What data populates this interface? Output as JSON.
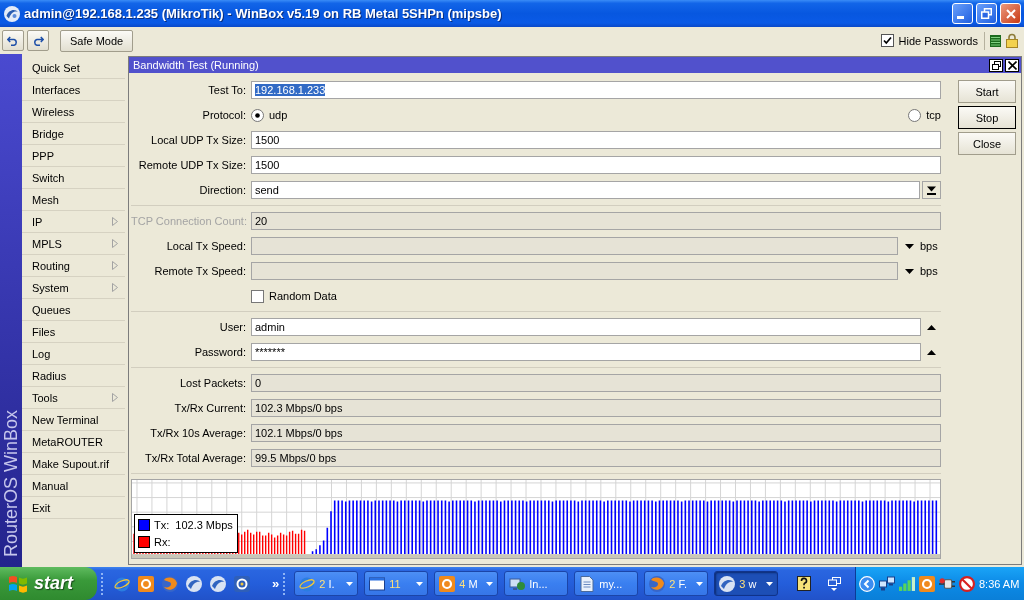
{
  "window": {
    "title": "admin@192.168.1.235 (MikroTik) - WinBox v5.19 on RB Metal 5SHPn (mipsbe)"
  },
  "toolbar": {
    "safe_mode": "Safe Mode",
    "hide_passwords": {
      "label": "Hide Passwords",
      "checked": true
    }
  },
  "sidebar": {
    "brand": "RouterOS WinBox",
    "items": [
      {
        "label": "Quick Set",
        "submenu": false
      },
      {
        "label": "Interfaces",
        "submenu": false
      },
      {
        "label": "Wireless",
        "submenu": false
      },
      {
        "label": "Bridge",
        "submenu": false
      },
      {
        "label": "PPP",
        "submenu": false
      },
      {
        "label": "Switch",
        "submenu": false
      },
      {
        "label": "Mesh",
        "submenu": false
      },
      {
        "label": "IP",
        "submenu": true
      },
      {
        "label": "MPLS",
        "submenu": true
      },
      {
        "label": "Routing",
        "submenu": true
      },
      {
        "label": "System",
        "submenu": true
      },
      {
        "label": "Queues",
        "submenu": false
      },
      {
        "label": "Files",
        "submenu": false
      },
      {
        "label": "Log",
        "submenu": false
      },
      {
        "label": "Radius",
        "submenu": false
      },
      {
        "label": "Tools",
        "submenu": true
      },
      {
        "label": "New Terminal",
        "submenu": false
      },
      {
        "label": "MetaROUTER",
        "submenu": false
      },
      {
        "label": "Make Supout.rif",
        "submenu": false
      },
      {
        "label": "Manual",
        "submenu": false
      },
      {
        "label": "Exit",
        "submenu": false
      }
    ]
  },
  "dialog": {
    "title": "Bandwidth Test (Running)",
    "sections": [
      {
        "rows": [
          {
            "kind": "text",
            "label": "Test To:",
            "value": "192.168.1.233",
            "highlighted": true,
            "disabled": false
          },
          {
            "kind": "radio",
            "label": "Protocol:",
            "disabled": false,
            "options": [
              {
                "label": "udp",
                "selected": true
              },
              {
                "label": "tcp",
                "selected": false
              }
            ]
          },
          {
            "kind": "text",
            "label": "Local UDP Tx Size:",
            "value": "1500",
            "highlighted": false,
            "disabled": false
          },
          {
            "kind": "text",
            "label": "Remote UDP Tx Size:",
            "value": "1500",
            "highlighted": false,
            "disabled": false
          },
          {
            "kind": "select",
            "label": "Direction:",
            "value": "send",
            "disabled": false
          }
        ]
      },
      {
        "rows": [
          {
            "kind": "readonly",
            "label": "TCP Connection Count:",
            "value": "20",
            "disabled": true
          },
          {
            "kind": "speed",
            "label": "Local Tx Speed:",
            "unit": "bps",
            "disabled": false
          },
          {
            "kind": "speed",
            "label": "Remote Tx Speed:",
            "unit": "bps",
            "disabled": false
          },
          {
            "kind": "checkbox",
            "label": "Random Data",
            "checked": false,
            "disabled": false
          }
        ]
      },
      {
        "rows": [
          {
            "kind": "collapsible",
            "label": "User:",
            "value": "admin",
            "disabled": false
          },
          {
            "kind": "collapsible",
            "label": "Password:",
            "value": "*******",
            "disabled": false
          }
        ]
      },
      {
        "rows": [
          {
            "kind": "readonly",
            "label": "Lost Packets:",
            "value": "0",
            "disabled": false
          },
          {
            "kind": "readonly",
            "label": "Tx/Rx Current:",
            "value": "102.3 Mbps/0 bps",
            "disabled": false
          },
          {
            "kind": "readonly",
            "label": "Tx/Rx 10s Average:",
            "value": "102.1 Mbps/0 bps",
            "disabled": false
          },
          {
            "kind": "readonly",
            "label": "Tx/Rx Total Average:",
            "value": "99.5 Mbps/0 bps",
            "disabled": false
          }
        ]
      }
    ],
    "graph": {
      "legend": [
        {
          "label": "Tx:",
          "value": "102.3 Mbps",
          "color": "#0000ff"
        },
        {
          "label": "Rx:",
          "color": "#ff0000"
        }
      ]
    },
    "buttons": [
      {
        "label": "Start",
        "focused": false
      },
      {
        "label": "Stop",
        "focused": true
      },
      {
        "label": "Close",
        "focused": false
      }
    ]
  },
  "taskbar": {
    "start": "start",
    "overflow": "»",
    "tasks": [
      {
        "kind": "browser",
        "count": "2",
        "label": "I.",
        "grouped": true,
        "selected": false
      },
      {
        "kind": "window",
        "count": "11",
        "grouped": true,
        "selected": false
      },
      {
        "kind": "mail",
        "count": "4",
        "label": "M",
        "grouped": true,
        "selected": false
      },
      {
        "kind": "network",
        "label": "In...",
        "grouped": false,
        "selected": false
      },
      {
        "kind": "document",
        "label": "my...",
        "grouped": false,
        "selected": false
      },
      {
        "kind": "globe",
        "count": "2",
        "label": "F.",
        "grouped": true,
        "selected": false
      },
      {
        "kind": "disc",
        "count": "3",
        "label": "w",
        "grouped": true,
        "selected": true
      }
    ],
    "clock": "8:36 AM"
  }
}
